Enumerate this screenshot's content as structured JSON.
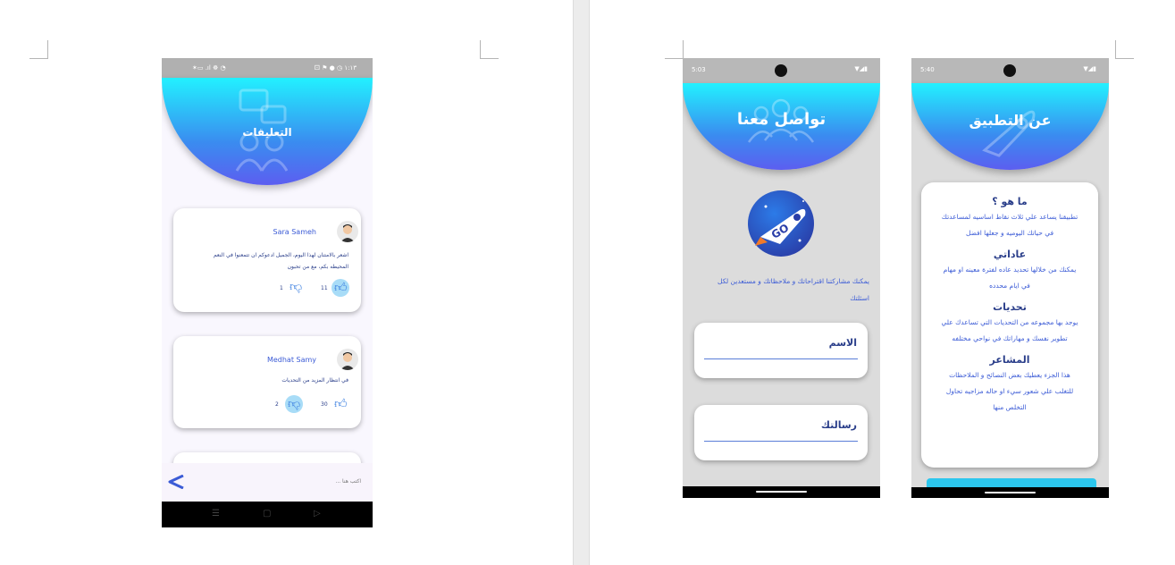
{
  "comments_screen": {
    "status_left": "✶▭ .ıl ☸ ◔",
    "status_right": "⚀ ⚑ ● ◷ ١:١٣",
    "title": "التعليقات",
    "comments": [
      {
        "author": "Sara Sameh",
        "text_line1": "اشعر بالامتنان لهذا اليوم، الجميل ادعوكم ان تتمعنوا في النعم",
        "text_line2": "المحيطه بكم، مع من تحبون",
        "likes": "11",
        "dislikes": "1"
      },
      {
        "author": "Medhat Samy",
        "text_line1": "في انتظار المزيد من التحديات",
        "likes": "30",
        "dislikes": "2"
      }
    ],
    "input_placeholder": "اكتب هنا ...",
    "send_icon": "send-arrow-icon",
    "nav_menu": "☰",
    "nav_home": "▢",
    "nav_back": "▷"
  },
  "contact_screen": {
    "time": "5:03",
    "status_icons": "▼◢▮",
    "title": "تواصل معنا",
    "logo_text": "GO",
    "description_line1": "يمكنك مشاركتنا اقتراحاتك و ملاحظاتك و مستعدين لكل",
    "description_line2": "اسئلتك",
    "name_label": "الاسم",
    "message_label": "رسالتك"
  },
  "about_screen": {
    "time": "5:40",
    "status_icons": "▼◢▮",
    "title": "عن التطبيق",
    "sections": [
      {
        "heading": "ما هو ؟",
        "line1": "تطبيقنا يساعد علي ثلاث نقاط اساسيه لمساعدتك",
        "line2": "في حياتك اليوميه و جعلها افضل",
        "line3": ""
      },
      {
        "heading": "عاداتي",
        "line1": "يمكنك من خلالها تحديد عاده لفترة معينه او مهام",
        "line2": "في ايام محدده",
        "line3": ""
      },
      {
        "heading": "تحديات",
        "line1": "يوجد بها مجموعه من التحديات التي تساعدك علي",
        "line2": "تطوير نفسك و مهاراتك في نواحي مختلفه",
        "line3": ""
      },
      {
        "heading": "المشاعر",
        "line1": "هذا الجزء يعطيك بعض النصائح و الملاحظات",
        "line2": "للتغلب علي شعور سيء او حاله مزاجيه تحاول",
        "line3": "التخلص منها"
      }
    ]
  },
  "colors": {
    "accent": "#3b5bd6",
    "gradient_top": "#22f1ff",
    "gradient_bottom": "#5c5ef0",
    "grey_bg": "#dcdcdc"
  }
}
